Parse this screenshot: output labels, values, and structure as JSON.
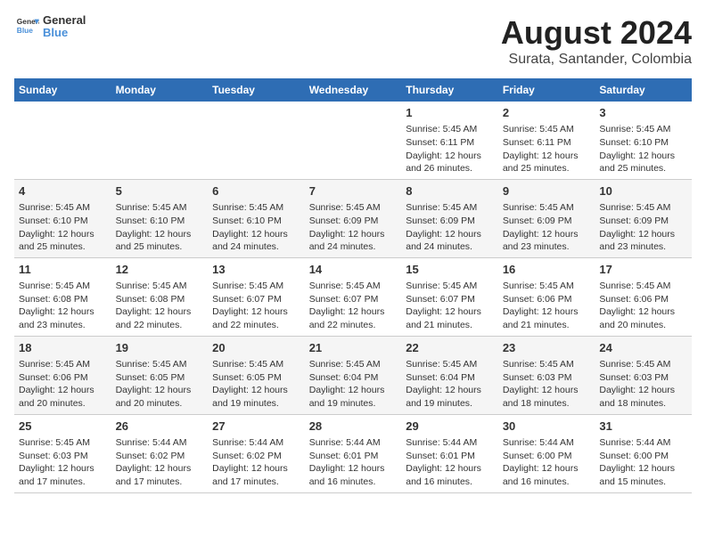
{
  "header": {
    "logo_line1": "General",
    "logo_line2": "Blue",
    "main_title": "August 2024",
    "subtitle": "Surata, Santander, Colombia"
  },
  "days_of_week": [
    "Sunday",
    "Monday",
    "Tuesday",
    "Wednesday",
    "Thursday",
    "Friday",
    "Saturday"
  ],
  "weeks": [
    [
      {
        "day": "",
        "info": ""
      },
      {
        "day": "",
        "info": ""
      },
      {
        "day": "",
        "info": ""
      },
      {
        "day": "",
        "info": ""
      },
      {
        "day": "1",
        "info": "Sunrise: 5:45 AM\nSunset: 6:11 PM\nDaylight: 12 hours\nand 26 minutes."
      },
      {
        "day": "2",
        "info": "Sunrise: 5:45 AM\nSunset: 6:11 PM\nDaylight: 12 hours\nand 25 minutes."
      },
      {
        "day": "3",
        "info": "Sunrise: 5:45 AM\nSunset: 6:10 PM\nDaylight: 12 hours\nand 25 minutes."
      }
    ],
    [
      {
        "day": "4",
        "info": "Sunrise: 5:45 AM\nSunset: 6:10 PM\nDaylight: 12 hours\nand 25 minutes."
      },
      {
        "day": "5",
        "info": "Sunrise: 5:45 AM\nSunset: 6:10 PM\nDaylight: 12 hours\nand 25 minutes."
      },
      {
        "day": "6",
        "info": "Sunrise: 5:45 AM\nSunset: 6:10 PM\nDaylight: 12 hours\nand 24 minutes."
      },
      {
        "day": "7",
        "info": "Sunrise: 5:45 AM\nSunset: 6:09 PM\nDaylight: 12 hours\nand 24 minutes."
      },
      {
        "day": "8",
        "info": "Sunrise: 5:45 AM\nSunset: 6:09 PM\nDaylight: 12 hours\nand 24 minutes."
      },
      {
        "day": "9",
        "info": "Sunrise: 5:45 AM\nSunset: 6:09 PM\nDaylight: 12 hours\nand 23 minutes."
      },
      {
        "day": "10",
        "info": "Sunrise: 5:45 AM\nSunset: 6:09 PM\nDaylight: 12 hours\nand 23 minutes."
      }
    ],
    [
      {
        "day": "11",
        "info": "Sunrise: 5:45 AM\nSunset: 6:08 PM\nDaylight: 12 hours\nand 23 minutes."
      },
      {
        "day": "12",
        "info": "Sunrise: 5:45 AM\nSunset: 6:08 PM\nDaylight: 12 hours\nand 22 minutes."
      },
      {
        "day": "13",
        "info": "Sunrise: 5:45 AM\nSunset: 6:07 PM\nDaylight: 12 hours\nand 22 minutes."
      },
      {
        "day": "14",
        "info": "Sunrise: 5:45 AM\nSunset: 6:07 PM\nDaylight: 12 hours\nand 22 minutes."
      },
      {
        "day": "15",
        "info": "Sunrise: 5:45 AM\nSunset: 6:07 PM\nDaylight: 12 hours\nand 21 minutes."
      },
      {
        "day": "16",
        "info": "Sunrise: 5:45 AM\nSunset: 6:06 PM\nDaylight: 12 hours\nand 21 minutes."
      },
      {
        "day": "17",
        "info": "Sunrise: 5:45 AM\nSunset: 6:06 PM\nDaylight: 12 hours\nand 20 minutes."
      }
    ],
    [
      {
        "day": "18",
        "info": "Sunrise: 5:45 AM\nSunset: 6:06 PM\nDaylight: 12 hours\nand 20 minutes."
      },
      {
        "day": "19",
        "info": "Sunrise: 5:45 AM\nSunset: 6:05 PM\nDaylight: 12 hours\nand 20 minutes."
      },
      {
        "day": "20",
        "info": "Sunrise: 5:45 AM\nSunset: 6:05 PM\nDaylight: 12 hours\nand 19 minutes."
      },
      {
        "day": "21",
        "info": "Sunrise: 5:45 AM\nSunset: 6:04 PM\nDaylight: 12 hours\nand 19 minutes."
      },
      {
        "day": "22",
        "info": "Sunrise: 5:45 AM\nSunset: 6:04 PM\nDaylight: 12 hours\nand 19 minutes."
      },
      {
        "day": "23",
        "info": "Sunrise: 5:45 AM\nSunset: 6:03 PM\nDaylight: 12 hours\nand 18 minutes."
      },
      {
        "day": "24",
        "info": "Sunrise: 5:45 AM\nSunset: 6:03 PM\nDaylight: 12 hours\nand 18 minutes."
      }
    ],
    [
      {
        "day": "25",
        "info": "Sunrise: 5:45 AM\nSunset: 6:03 PM\nDaylight: 12 hours\nand 17 minutes."
      },
      {
        "day": "26",
        "info": "Sunrise: 5:44 AM\nSunset: 6:02 PM\nDaylight: 12 hours\nand 17 minutes."
      },
      {
        "day": "27",
        "info": "Sunrise: 5:44 AM\nSunset: 6:02 PM\nDaylight: 12 hours\nand 17 minutes."
      },
      {
        "day": "28",
        "info": "Sunrise: 5:44 AM\nSunset: 6:01 PM\nDaylight: 12 hours\nand 16 minutes."
      },
      {
        "day": "29",
        "info": "Sunrise: 5:44 AM\nSunset: 6:01 PM\nDaylight: 12 hours\nand 16 minutes."
      },
      {
        "day": "30",
        "info": "Sunrise: 5:44 AM\nSunset: 6:00 PM\nDaylight: 12 hours\nand 16 minutes."
      },
      {
        "day": "31",
        "info": "Sunrise: 5:44 AM\nSunset: 6:00 PM\nDaylight: 12 hours\nand 15 minutes."
      }
    ]
  ]
}
